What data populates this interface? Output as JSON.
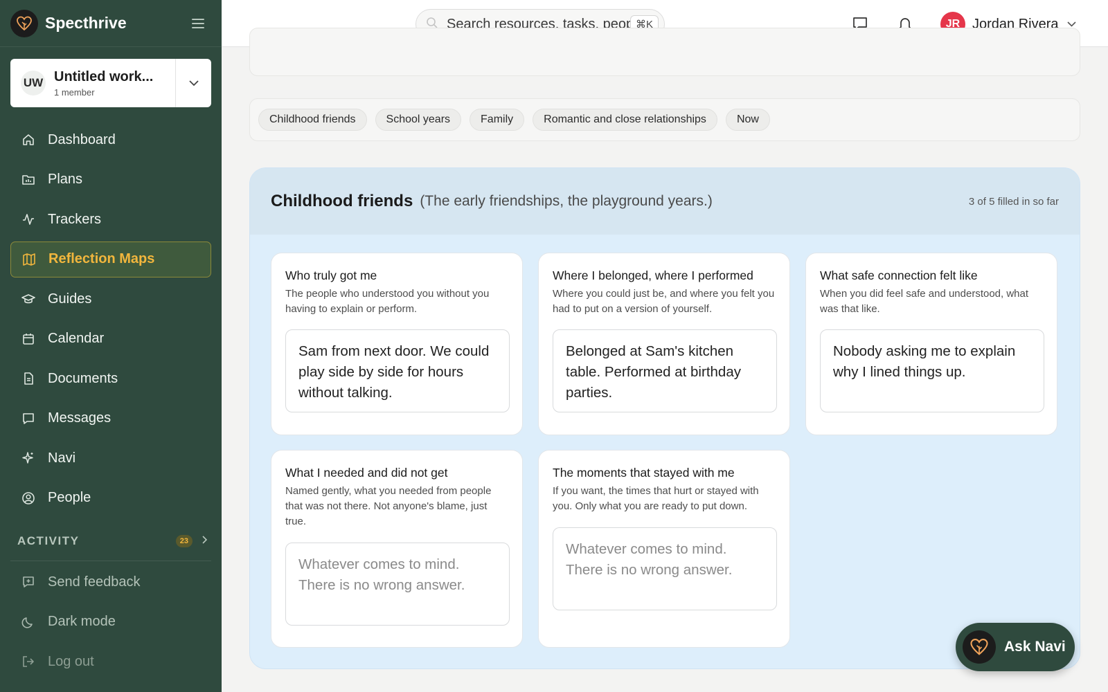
{
  "app": {
    "name": "Specthrive"
  },
  "workspace": {
    "initials": "UW",
    "name": "Untitled work...",
    "members": "1 member"
  },
  "sidebar": {
    "items": [
      {
        "label": "Dashboard",
        "icon": "home-icon"
      },
      {
        "label": "Plans",
        "icon": "folder-chart-icon"
      },
      {
        "label": "Trackers",
        "icon": "activity-icon"
      },
      {
        "label": "Reflection Maps",
        "icon": "map-icon",
        "active": true
      },
      {
        "label": "Guides",
        "icon": "graduation-cap-icon"
      },
      {
        "label": "Calendar",
        "icon": "calendar-icon"
      },
      {
        "label": "Documents",
        "icon": "document-icon"
      },
      {
        "label": "Messages",
        "icon": "message-icon"
      },
      {
        "label": "Navi",
        "icon": "sparkle-icon"
      },
      {
        "label": "People",
        "icon": "person-circle-icon"
      }
    ],
    "activity": {
      "label": "ACTIVITY",
      "count": "23"
    },
    "bottom": [
      {
        "label": "Send feedback",
        "icon": "feedback-icon"
      },
      {
        "label": "Dark mode",
        "icon": "moon-icon"
      },
      {
        "label": "Log out",
        "icon": "logout-icon"
      }
    ]
  },
  "header": {
    "search_placeholder": "Search resources, tasks, people...",
    "search_shortcut": "⌘K",
    "user": {
      "initials": "JR",
      "name": "Jordan Rivera"
    }
  },
  "chips": [
    "Childhood friends",
    "School years",
    "Family",
    "Romantic and close relationships",
    "Now"
  ],
  "section": {
    "title": "Childhood friends",
    "subtitle": "(The early friendships, the playground years.)",
    "progress": "3 of 5 filled in so far",
    "cards": [
      {
        "title": "Who truly got me",
        "desc": "The people who understood you without you having to explain or perform.",
        "answer": "Sam from next door. We could play side by side for hours without talking."
      },
      {
        "title": "Where I belonged, where I performed",
        "desc": "Where you could just be, and where you felt you had to put on a version of yourself.",
        "answer": "Belonged at Sam's kitchen table. Performed at birthday parties."
      },
      {
        "title": "What safe connection felt like",
        "desc": "When you did feel safe and understood, what was that like.",
        "answer": "Nobody asking me to explain why I lined things up."
      },
      {
        "title": "What I needed and did not get",
        "desc": "Named gently, what you needed from people that was not there. Not anyone's blame, just true.",
        "answer": "",
        "placeholder": "Whatever comes to mind. There is no wrong answer."
      },
      {
        "title": "The moments that stayed with me",
        "desc": "If you want, the times that hurt or stayed with you. Only what you are ready to put down.",
        "answer": "",
        "placeholder": "Whatever comes to mind. There is no wrong answer."
      }
    ]
  },
  "ask_navi": {
    "label": "Ask Navi"
  },
  "colors": {
    "sidebar": "#2f4a3e",
    "active_text": "#f2b63d",
    "section_bg": "#ddeefb",
    "user_avatar": "#e5364a"
  }
}
